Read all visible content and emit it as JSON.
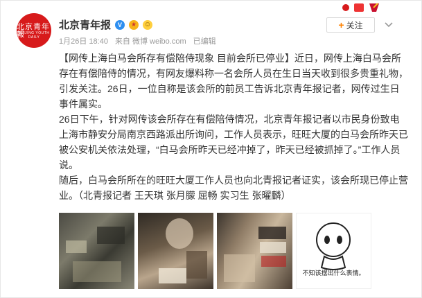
{
  "account": {
    "name": "北京青年报",
    "avatar_text": "北京青年報",
    "avatar_subtext": "BEIJING YOUTH DAILY"
  },
  "post_meta": {
    "date": "1月26日 18:40",
    "source": "来自 微博 weibo.com",
    "edited": "已编辑"
  },
  "follow_button": {
    "label": "关注"
  },
  "post_text": {
    "paragraph1": "【网传上海白马会所存有偿陪侍现象 目前会所已停业】近日，网传上海白马会所存在有偿陪侍的情况，有网友爆料称一名会所人员在生日当天收到很多贵重礼物，引发关注。26日，一位自称是该会所的前员工告诉北京青年报记者，网传过生日事件属实。",
    "paragraph2": "26日下午，针对网传该会所存在有偿陪侍情况，北京青年报记者以市民身份致电上海市静安分局南京西路派出所询问，工作人员表示，旺旺大厦的白马会所昨天已被公安机关依法处理，“白马会所昨天已经冲掉了，昨天已经被抓掉了。”工作人员说。",
    "paragraph3": "随后，白马会所所在的旺旺大厦工作人员也向北青报记者证实，该会所现已停止营业。（北青报记者 王天琪 张月朦 屈畅 实习生 张曜麟）"
  },
  "images": {
    "meme_caption": "不知该摆出什么表情。"
  },
  "icons": {
    "verified": "verified-v-icon",
    "medal": "medal-icon",
    "emoji": "smile-emoji-icon",
    "chevron": "chevron-down-icon"
  },
  "colors": {
    "brand_red": "#d71a1b",
    "verified_blue": "#2f8ff0",
    "follow_orange": "#ff8200"
  }
}
